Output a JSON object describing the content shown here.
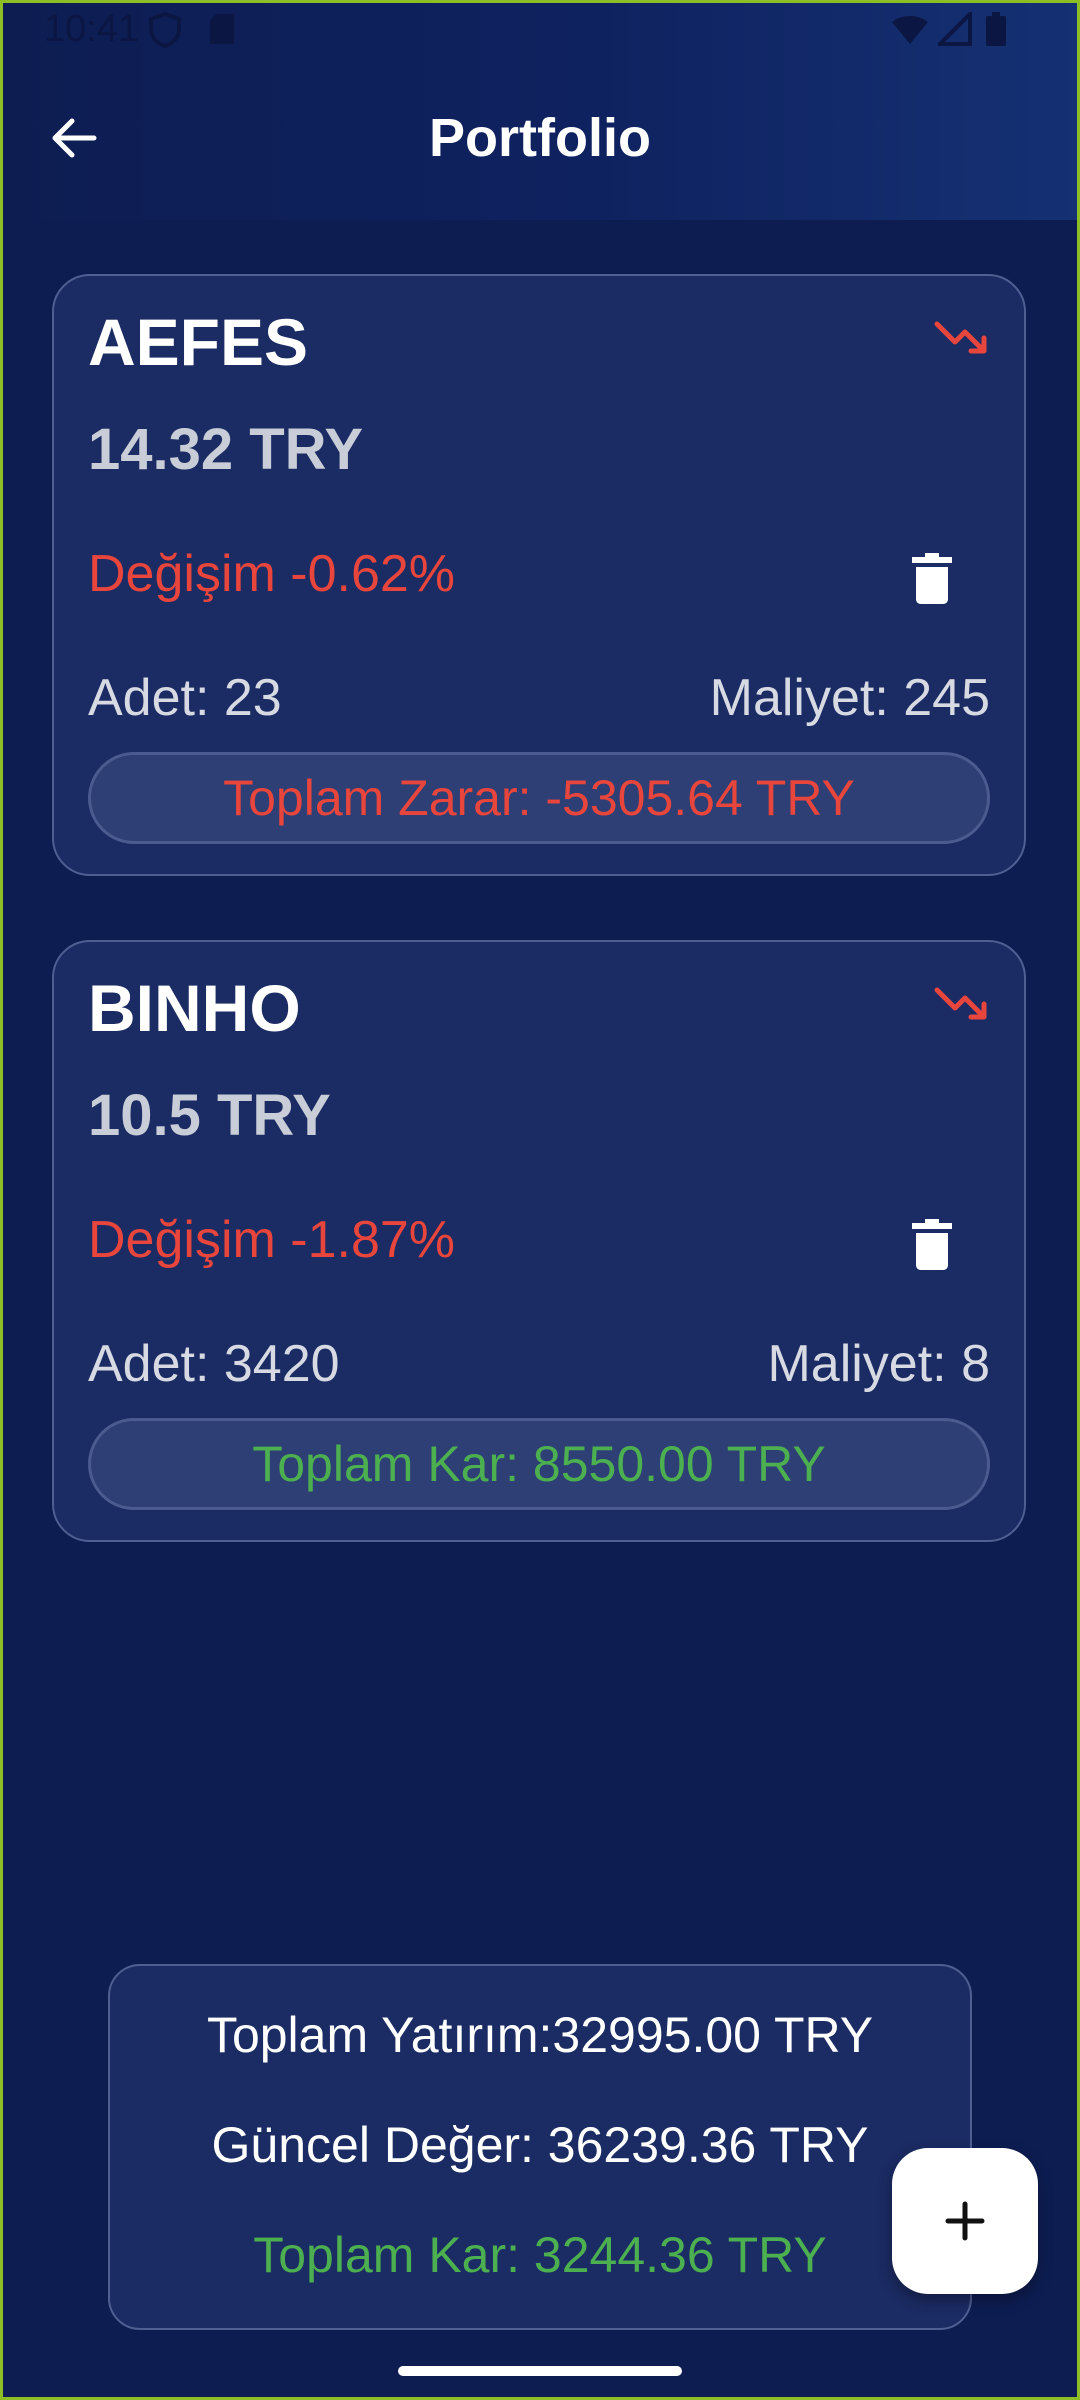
{
  "status_bar": {
    "time": "10:41"
  },
  "header": {
    "title": "Portfolio"
  },
  "stocks": [
    {
      "symbol": "AEFES",
      "price": "14.32 TRY",
      "change": "Değişim -0.62%",
      "quantity": "Adet: 23",
      "cost": "Maliyet: 245",
      "total": "Toplam Zarar: -5305.64 TRY",
      "total_kind": "loss"
    },
    {
      "symbol": "BINHO",
      "price": "10.5 TRY",
      "change": "Değişim -1.87%",
      "quantity": "Adet: 3420",
      "cost": "Maliyet: 8",
      "total": "Toplam Kar: 8550.00 TRY",
      "total_kind": "profit"
    }
  ],
  "summary": {
    "investment": "Toplam Yatırım:32995.00 TRY",
    "current_value": "Güncel Değer: 36239.36 TRY",
    "total_profit": "Toplam Kar: 3244.36 TRY"
  },
  "colors": {
    "background": "#0d1d52",
    "card": "#1b2b63",
    "loss": "#e8453c",
    "profit": "#4caf50"
  },
  "icons": {
    "back": "arrow-left-icon",
    "trend": "trending-down-icon",
    "delete": "trash-icon",
    "add": "plus-icon"
  }
}
